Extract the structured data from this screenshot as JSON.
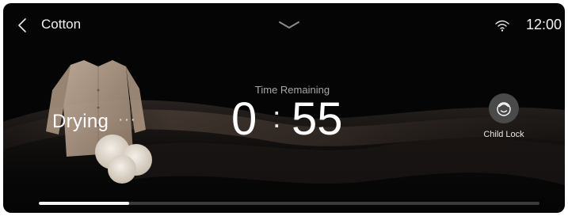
{
  "header": {
    "back_icon": "chevron-left-icon",
    "program_name": "Cotton",
    "collapse_icon": "chevron-down-icon",
    "wifi_icon": "wifi-icon",
    "clock": "12:00"
  },
  "status": {
    "cycle_stage": "Drying",
    "dots": "···"
  },
  "timer": {
    "label": "Time Remaining",
    "hours": "0",
    "separator": ":",
    "minutes": "55"
  },
  "child_lock": {
    "label": "Child Lock",
    "icon": "child-lock-icon"
  },
  "progress": {
    "fraction": 0.18
  },
  "colors": {
    "background": "#050505",
    "text": "#ffffff",
    "muted_text": "#a8a8a8",
    "progress_fill": "#f4f4f4",
    "progress_track": "#3a3a3a"
  }
}
